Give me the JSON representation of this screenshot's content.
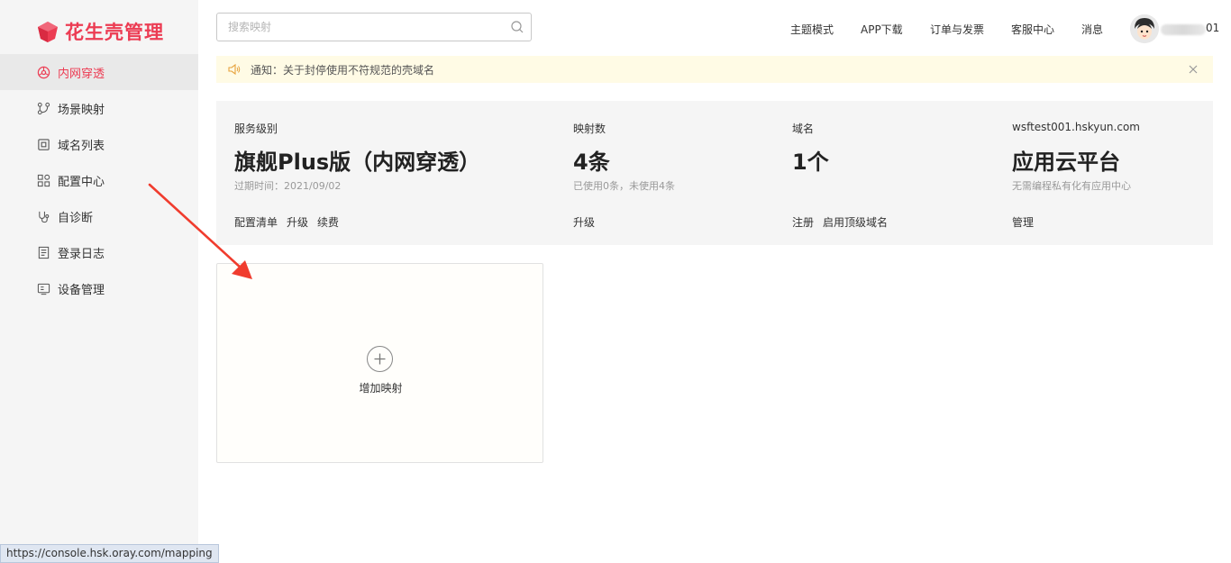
{
  "brand": {
    "name": "花生壳管理",
    "color": "#ec3c53"
  },
  "sidebar": {
    "items": [
      {
        "label": "内网穿透",
        "icon": "network-icon",
        "active": true
      },
      {
        "label": "场景映射",
        "icon": "scene-icon",
        "active": false
      },
      {
        "label": "域名列表",
        "icon": "domain-icon",
        "active": false
      },
      {
        "label": "配置中心",
        "icon": "grid-icon",
        "active": false
      },
      {
        "label": "自诊断",
        "icon": "diagnose-icon",
        "active": false
      },
      {
        "label": "登录日志",
        "icon": "log-icon",
        "active": false
      },
      {
        "label": "设备管理",
        "icon": "device-icon",
        "active": false
      }
    ]
  },
  "header": {
    "search_placeholder": "搜索映射",
    "nav": [
      "主题模式",
      "APP下载",
      "订单与发票",
      "客服中心",
      "消息"
    ],
    "username_tail": "01"
  },
  "notice": {
    "text": "通知：关于封停使用不符规范的壳域名"
  },
  "stats": {
    "service": {
      "label": "服务级别",
      "value": "旗舰Plus版（内网穿透）",
      "sub": "过期时间：2021/09/02",
      "links": [
        "配置清单",
        "升级",
        "续费"
      ]
    },
    "mappings": {
      "label": "映射数",
      "value": "4条",
      "sub": "已使用0条，未使用4条",
      "links": [
        "升级"
      ]
    },
    "domains": {
      "label": "域名",
      "value": "1个",
      "sub": "",
      "links": [
        "注册",
        "启用顶级域名"
      ]
    },
    "platform": {
      "label": "wsftest001.hskyun.com",
      "value": "应用云平台",
      "sub": "无需编程私有化有应用中心",
      "links": [
        "管理"
      ]
    }
  },
  "add_card": {
    "label": "增加映射"
  },
  "status_bar": {
    "url": "https://console.hsk.oray.com/mapping"
  }
}
